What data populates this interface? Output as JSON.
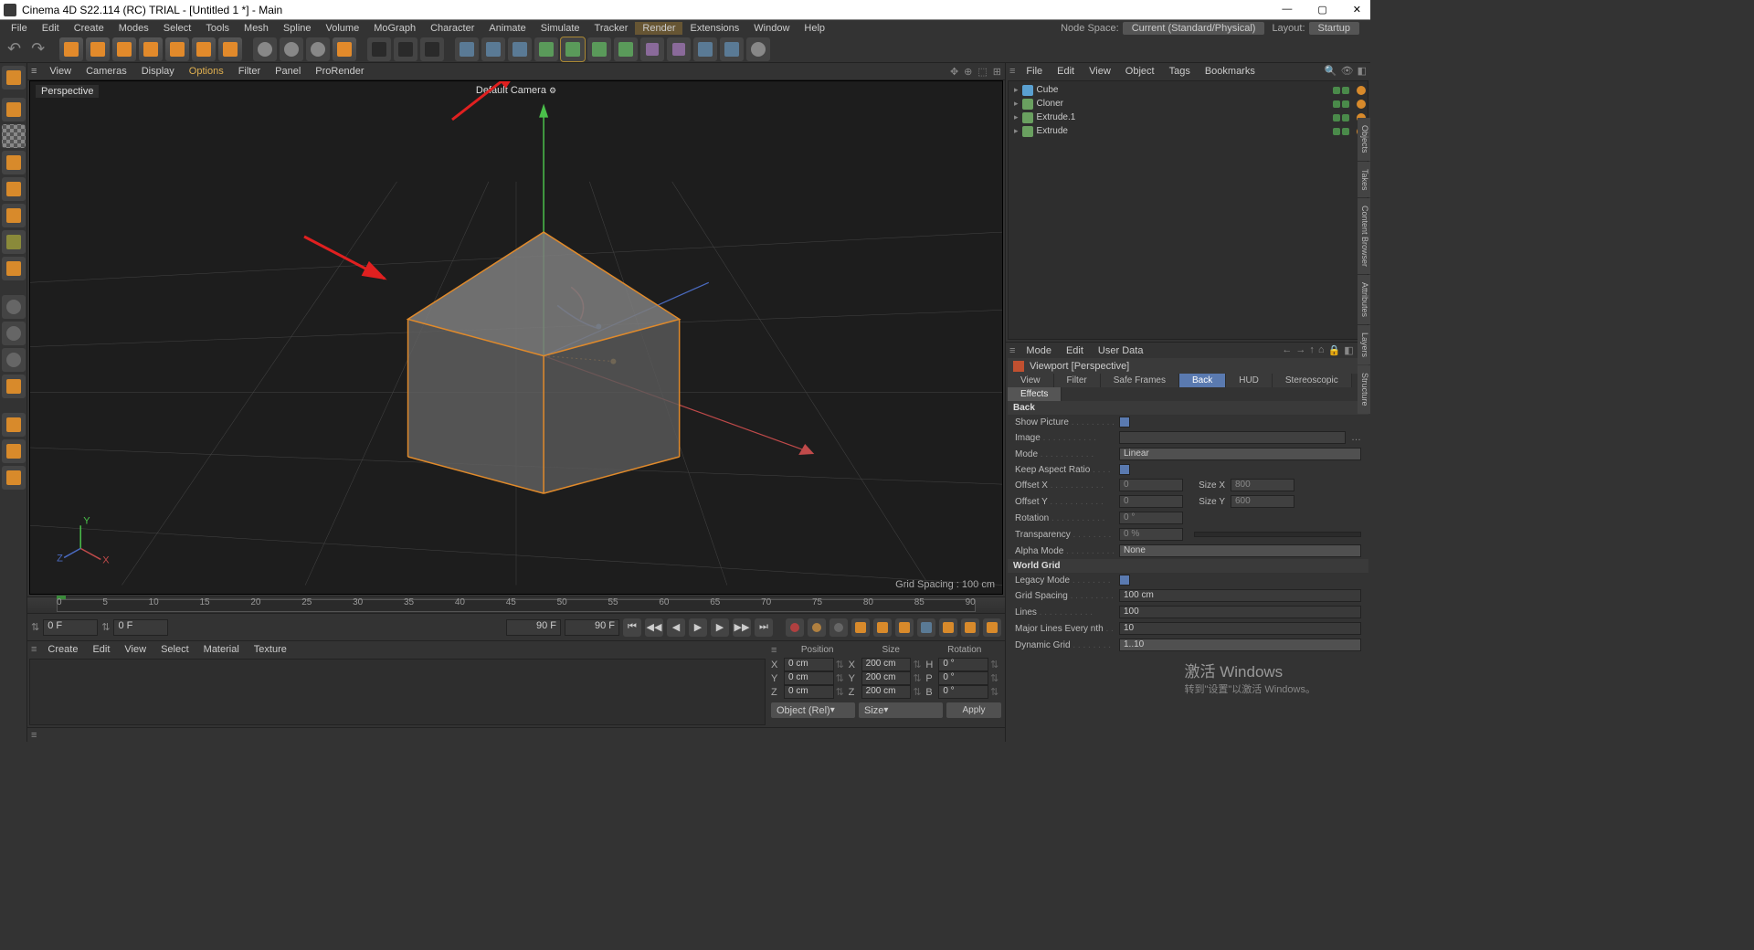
{
  "window": {
    "title": "Cinema 4D S22.114 (RC) TRIAL - [Untitled 1 *] - Main"
  },
  "menu": {
    "items": [
      "File",
      "Edit",
      "Create",
      "Modes",
      "Select",
      "Tools",
      "Mesh",
      "Spline",
      "Volume",
      "MoGraph",
      "Character",
      "Animate",
      "Simulate",
      "Tracker",
      "Render",
      "Extensions",
      "Window",
      "Help"
    ],
    "nodeSpaceLabel": "Node Space:",
    "nodeSpace": "Current (Standard/Physical)",
    "layoutLabel": "Layout:",
    "layout": "Startup"
  },
  "viewportMenu": [
    "View",
    "Cameras",
    "Display",
    "Options",
    "Filter",
    "Panel",
    "ProRender"
  ],
  "viewport": {
    "label": "Perspective",
    "camera": "Default Camera",
    "gridSpacing": "Grid Spacing : 100 cm"
  },
  "timeline": {
    "ticks": [
      "0",
      "5",
      "10",
      "15",
      "20",
      "25",
      "30",
      "35",
      "40",
      "45",
      "50",
      "55",
      "60",
      "65",
      "70",
      "75",
      "80",
      "85",
      "90"
    ],
    "startFrame": "0 F",
    "frameA": "0 F",
    "frameB": "90 F",
    "frameC": "90 F",
    "endLabel": "0 F"
  },
  "materialMenu": [
    "Create",
    "Edit",
    "View",
    "Select",
    "Material",
    "Texture"
  ],
  "coord": {
    "headers": [
      "Position",
      "Size",
      "Rotation"
    ],
    "rows": [
      {
        "axis": "X",
        "pos": "0 cm",
        "size": "200 cm",
        "rotAxis": "H",
        "rot": "0 °"
      },
      {
        "axis": "Y",
        "pos": "0 cm",
        "size": "200 cm",
        "rotAxis": "P",
        "rot": "0 °"
      },
      {
        "axis": "Z",
        "pos": "0 cm",
        "size": "200 cm",
        "rotAxis": "B",
        "rot": "0 °"
      }
    ],
    "mode1": "Object (Rel)",
    "mode2": "Size",
    "apply": "Apply"
  },
  "objectManager": {
    "menu": [
      "File",
      "Edit",
      "View",
      "Object",
      "Tags",
      "Bookmarks"
    ],
    "items": [
      {
        "name": "Cube",
        "color": "#5aa0d0"
      },
      {
        "name": "Cloner",
        "color": "#6aa060"
      },
      {
        "name": "Extrude.1",
        "color": "#6aa060"
      },
      {
        "name": "Extrude",
        "color": "#6aa060"
      }
    ]
  },
  "attributeManager": {
    "menu": [
      "Mode",
      "Edit",
      "User Data"
    ],
    "title": "Viewport [Perspective]",
    "tabs": [
      "View",
      "Filter",
      "Safe Frames",
      "Back",
      "HUD",
      "Stereoscopic"
    ],
    "subtabs": [
      "Effects"
    ],
    "activeTab": "Back",
    "sections": {
      "back": {
        "title": "Back",
        "showPicture": true,
        "image": "",
        "mode": "Linear",
        "keepAspect": true,
        "offsetX": "0",
        "sizeX": "800",
        "offsetY": "0",
        "sizeY": "600",
        "rotation": "0 °",
        "transparency": "0 %",
        "alphaMode": "None"
      },
      "worldGrid": {
        "title": "World Grid",
        "legacyMode": true,
        "gridSpacing": "100 cm",
        "lines": "100",
        "majorLines": "10",
        "dynamicGrid": "1..10"
      }
    }
  },
  "sideTabs": [
    "Objects",
    "Takes",
    "Content Browser",
    "Attributes",
    "Layers",
    "Structure"
  ],
  "watermark": {
    "line1": "激活 Windows",
    "line2": "转到\"设置\"以激活 Windows。"
  }
}
